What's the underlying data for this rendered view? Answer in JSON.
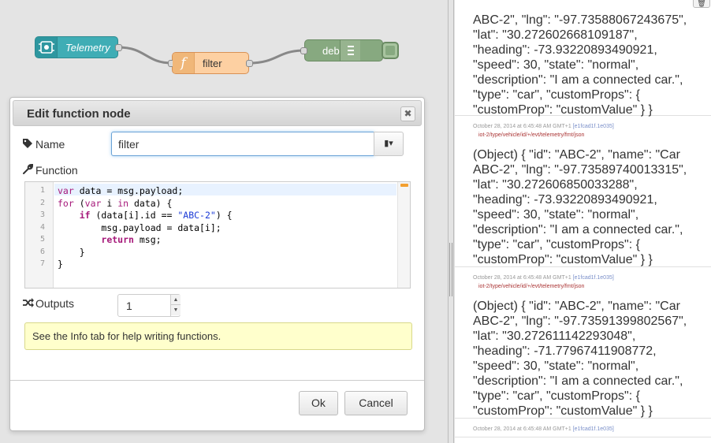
{
  "flow": {
    "nodes": {
      "telemetry": "Telemetry",
      "filter": "filter",
      "debug": "debug"
    }
  },
  "dialog": {
    "title": "Edit function node",
    "close_glyph": "✖",
    "name_label": "Name",
    "name_value": "filter",
    "function_label": "Function",
    "code_lines": [
      {
        "n": "1",
        "html": "<span class=\"kw\">var</span> data = msg.payload;"
      },
      {
        "n": "2",
        "html": "<span class=\"kw\">for</span> (<span class=\"kw\">var</span> i <span class=\"kw\">in</span> data) {"
      },
      {
        "n": "3",
        "html": "    <span class=\"kw strong\">if</span> (data[i].id == <span class=\"str\">\"ABC-2\"</span>) {"
      },
      {
        "n": "4",
        "html": "        msg.payload = data[i];"
      },
      {
        "n": "5",
        "html": "        <span class=\"kw strong\">return</span> msg;"
      },
      {
        "n": "6",
        "html": "    }"
      },
      {
        "n": "7",
        "html": "}"
      }
    ],
    "outputs_label": "Outputs",
    "outputs_value": "1",
    "info_tip": "See the Info tab for help writing functions.",
    "ok_label": "Ok",
    "cancel_label": "Cancel"
  },
  "debug": {
    "messages": [
      {
        "meta": "",
        "id": "",
        "topic": "",
        "lines": [
          "ABC-2\", \"lng\": \"-97.73588067243675\",",
          "\"lat\": \"30.272602668109187\",",
          "\"heading\": -73.93220893490921,",
          "\"speed\": 30, \"state\": \"normal\",",
          "\"description\": \"I am a connected car.\",",
          "\"type\": \"car\", \"customProps\": {",
          "\"customProp\": \"customValue\" } }"
        ]
      },
      {
        "meta": "October 28, 2014 at 6:45:48 AM GMT+1",
        "id": "[e1fcad1f.1e035]",
        "topic": "iot-2/type/vehicle/id/+/evt/telemetry/fmt/json",
        "lines": [
          "(Object) { \"id\": \"ABC-2\", \"name\": \"Car",
          "ABC-2\", \"lng\": \"-97.73589740013315\",",
          "\"lat\": \"30.272606850033288\",",
          "\"heading\": -73.93220893490921,",
          "\"speed\": 30, \"state\": \"normal\",",
          "\"description\": \"I am a connected car.\",",
          "\"type\": \"car\", \"customProps\": {",
          "\"customProp\": \"customValue\" } }"
        ]
      },
      {
        "meta": "October 28, 2014 at 6:45:48 AM GMT+1",
        "id": "[e1fcad1f.1e035]",
        "topic": "iot-2/type/vehicle/id/+/evt/telemetry/fmt/json",
        "lines": [
          "(Object) { \"id\": \"ABC-2\", \"name\": \"Car",
          "ABC-2\", \"lng\": \"-97.73591399802567\",",
          "\"lat\": \"30.272611142293048\",",
          "\"heading\": -71.77967411908772,",
          "\"speed\": 30, \"state\": \"normal\",",
          "\"description\": \"I am a connected car.\",",
          "\"type\": \"car\", \"customProps\": {",
          "\"customProp\": \"customValue\" } }"
        ]
      },
      {
        "meta": "October 28, 2014 at 6:45:48 AM GMT+1",
        "id": "[e1fcad1f.1e035]",
        "topic": "",
        "lines": []
      }
    ]
  }
}
